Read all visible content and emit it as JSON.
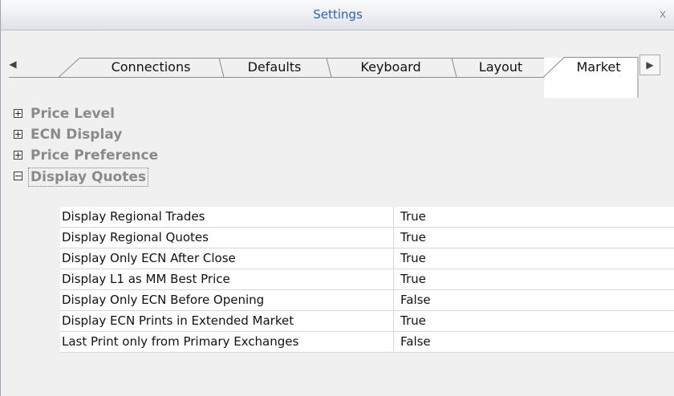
{
  "window": {
    "title": "Settings",
    "close_glyph": "x"
  },
  "tabs": [
    {
      "label": "Connections",
      "active": false
    },
    {
      "label": "Defaults",
      "active": false
    },
    {
      "label": "Keyboard",
      "active": false
    },
    {
      "label": "Layout",
      "active": false
    },
    {
      "label": "Market",
      "active": true
    }
  ],
  "tab_scroll": {
    "left_glyph": "◀",
    "right_glyph": "▶"
  },
  "groups": [
    {
      "label": "Price Level",
      "expanded": false
    },
    {
      "label": "ECN Display",
      "expanded": false
    },
    {
      "label": "Price Preference",
      "expanded": false
    },
    {
      "label": "Display Quotes",
      "expanded": true
    }
  ],
  "properties": [
    {
      "name": "Display Regional Trades",
      "value": "True"
    },
    {
      "name": "Display Regional Quotes",
      "value": "True"
    },
    {
      "name": "Display Only ECN After Close",
      "value": "True"
    },
    {
      "name": "Display L1 as MM Best Price",
      "value": "True"
    },
    {
      "name": "Display Only ECN Before Opening",
      "value": "False"
    },
    {
      "name": "Display ECN Prints in Extended Market",
      "value": "True"
    },
    {
      "name": "Last Print only from Primary Exchanges",
      "value": "False"
    }
  ],
  "colors": {
    "title_text": "#2a63b8",
    "group_text": "#8a8a8a"
  }
}
